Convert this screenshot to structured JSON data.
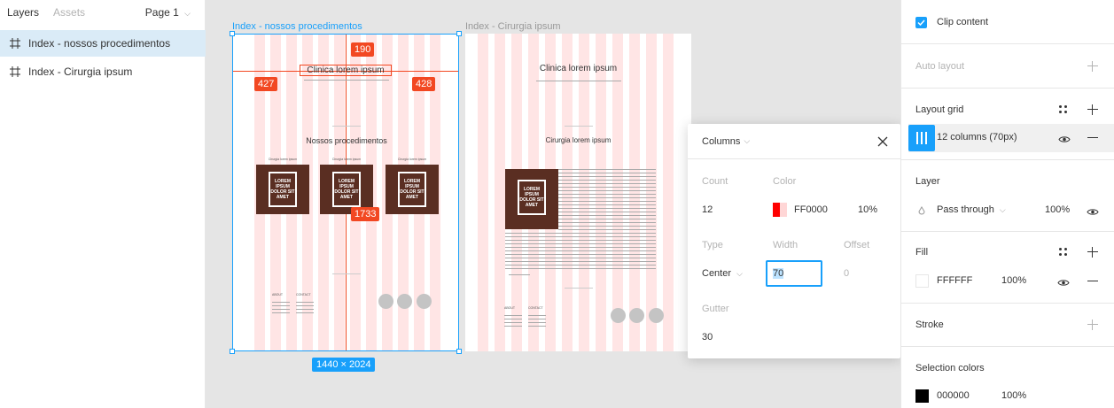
{
  "left_panel": {
    "tabs": {
      "layers": "Layers",
      "assets": "Assets"
    },
    "page_selector": "Page 1",
    "layers": [
      {
        "name": "Index - nossos procedimentos",
        "selected": true
      },
      {
        "name": "Index - Cirurgia ipsum",
        "selected": false
      }
    ]
  },
  "canvas": {
    "frame1": {
      "label": "Index - nossos procedimentos",
      "title": "Clinica lorem ipsum",
      "section_title": "Nossos procedimentos",
      "card_text": "LOREM IPSUM DOLOR SIT AMET",
      "card_labels": [
        "Cirurgia lorem ipsum",
        "Cirurgia lorem ipsum",
        "Cirurgia lorem ipsum"
      ],
      "footer_cols": [
        "ABOUT",
        "CONTACT"
      ],
      "measure_top": "190",
      "measure_left": "427",
      "measure_right": "428",
      "measure_bottom": "1733",
      "size": "1440 × 2024"
    },
    "frame2": {
      "label": "Index - Cirurgia ipsum",
      "title": "Clinica lorem ipsum",
      "section_title": "Cirurgia lorem ipsum",
      "card_text": "LOREM IPSUM DOLOR SIT AMET",
      "footer_cols": [
        "ABOUT",
        "CONTACT"
      ]
    }
  },
  "grid_popup": {
    "type_header": "Columns",
    "labels": {
      "count": "Count",
      "color": "Color",
      "type": "Type",
      "width": "Width",
      "offset": "Offset",
      "gutter": "Gutter"
    },
    "count": "12",
    "color_hex": "FF0000",
    "color_opacity": "10%",
    "type_value": "Center",
    "width": "70",
    "offset": "0",
    "gutter": "30",
    "accent_color": "#18a0fb",
    "grid_color": "#ff0000"
  },
  "right_panel": {
    "clip_content": "Clip content",
    "auto_layout": "Auto layout",
    "layout_grid": {
      "title": "Layout grid",
      "item": "12 columns (70px)"
    },
    "layer": {
      "title": "Layer",
      "blend": "Pass through",
      "opacity": "100%"
    },
    "fill": {
      "title": "Fill",
      "hex": "FFFFFF",
      "opacity": "100%"
    },
    "stroke": "Stroke",
    "selection_colors": {
      "title": "Selection colors",
      "hex": "000000",
      "opacity": "100%"
    }
  }
}
